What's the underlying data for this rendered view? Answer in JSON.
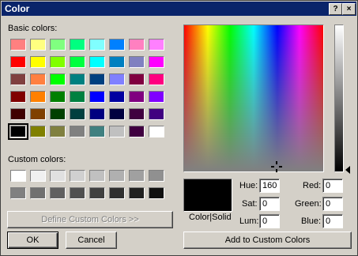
{
  "window": {
    "title": "Color",
    "help_label": "?",
    "close_label": "×"
  },
  "basic": {
    "label": "Basic colors:",
    "colors": [
      [
        "#ff8080",
        "#ffff80",
        "#80ff80",
        "#00ff80",
        "#80ffff",
        "#0080ff",
        "#ff80c0",
        "#ff80ff"
      ],
      [
        "#ff0000",
        "#ffff00",
        "#80ff00",
        "#00ff40",
        "#00ffff",
        "#0080c0",
        "#8080c0",
        "#ff00ff"
      ],
      [
        "#804040",
        "#ff8040",
        "#00ff00",
        "#008080",
        "#004080",
        "#8080ff",
        "#800040",
        "#ff0080"
      ],
      [
        "#800000",
        "#ff8000",
        "#008000",
        "#008040",
        "#0000ff",
        "#0000a0",
        "#800080",
        "#8000ff"
      ],
      [
        "#400000",
        "#804000",
        "#004000",
        "#004040",
        "#000080",
        "#000040",
        "#400040",
        "#400080"
      ],
      [
        "#000000",
        "#808000",
        "#808040",
        "#808080",
        "#408080",
        "#c0c0c0",
        "#400040",
        "#ffffff"
      ]
    ],
    "selected": "#000000"
  },
  "custom": {
    "label": "Custom colors:",
    "colors": [
      [
        "#ffffff",
        "#f0f0f0",
        "#e0e0e0",
        "#d0d0d0",
        "#c0c0c0",
        "#b0b0b0",
        "#a0a0a0",
        "#909090"
      ],
      [
        "#808080",
        "#707070",
        "#606060",
        "#505050",
        "#404040",
        "#303030",
        "#202020",
        "#101010"
      ]
    ]
  },
  "buttons": {
    "define": "Define Custom Colors >>",
    "ok": "OK",
    "cancel": "Cancel",
    "add": "Add to Custom Colors"
  },
  "preview": {
    "label": "Color|Solid",
    "color": "#000000"
  },
  "values": {
    "hue": {
      "label": "Hue:",
      "value": "160"
    },
    "sat": {
      "label": "Sat:",
      "value": "0"
    },
    "lum": {
      "label": "Lum:",
      "value": "0"
    },
    "red": {
      "label": "Red:",
      "value": "0"
    },
    "green": {
      "label": "Green:",
      "value": "0"
    },
    "blue": {
      "label": "Blue:",
      "value": "0"
    }
  }
}
